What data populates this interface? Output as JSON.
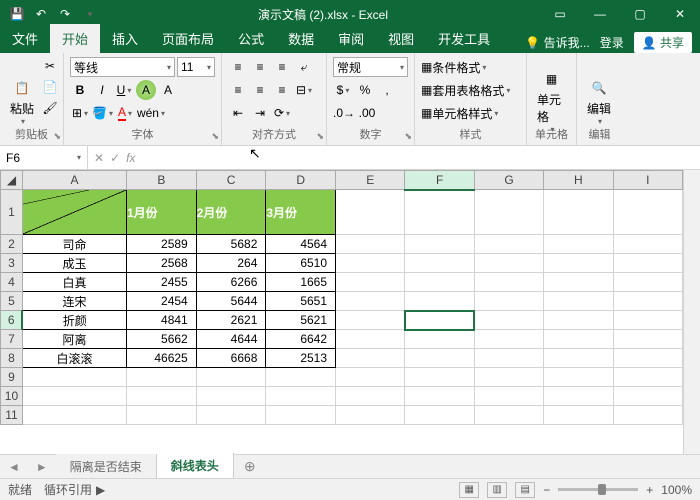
{
  "title": "演示文稿 (2).xlsx - Excel",
  "qat": {
    "save": "💾",
    "undo": "↶",
    "redo": "↷"
  },
  "tabs": {
    "file": "文件",
    "home": "开始",
    "insert": "插入",
    "layout": "页面布局",
    "formulas": "公式",
    "data": "数据",
    "review": "审阅",
    "view": "视图",
    "dev": "开发工具",
    "tell": "告诉我...",
    "login": "登录",
    "share": "共享"
  },
  "ribbon": {
    "clipboard": {
      "label": "剪贴板",
      "paste": "粘贴"
    },
    "font": {
      "label": "字体",
      "name": "等线",
      "size": "11",
      "bold": "B",
      "italic": "I",
      "underline": "U"
    },
    "align": {
      "label": "对齐方式"
    },
    "number": {
      "label": "数字",
      "format": "常规"
    },
    "styles": {
      "label": "样式",
      "cond": "条件格式",
      "table": "套用表格格式",
      "cell": "单元格样式"
    },
    "cells": {
      "label": "单元格"
    },
    "editing": {
      "label": "编辑"
    }
  },
  "namebox": "F6",
  "cols": [
    "A",
    "B",
    "C",
    "D",
    "E",
    "F",
    "G",
    "H",
    "I"
  ],
  "headers": [
    "",
    "1月份",
    "2月份",
    "3月份"
  ],
  "rows": [
    {
      "n": "司命",
      "v": [
        2589,
        5682,
        4564
      ]
    },
    {
      "n": "成玉",
      "v": [
        2568,
        264,
        6510
      ]
    },
    {
      "n": "白真",
      "v": [
        2455,
        6266,
        1665
      ]
    },
    {
      "n": "连宋",
      "v": [
        2454,
        5644,
        5651
      ]
    },
    {
      "n": "折颜",
      "v": [
        4841,
        2621,
        5621
      ]
    },
    {
      "n": "阿离",
      "v": [
        5662,
        4644,
        6642
      ]
    },
    {
      "n": "白滚滚",
      "v": [
        46625,
        6668,
        2513
      ]
    }
  ],
  "sheets": {
    "s1": "隔离是否结束",
    "s2": "斜线表头"
  },
  "status": {
    "ready": "就绪",
    "circ": "循环引用",
    "zoom": "100%"
  },
  "colwidths": {
    "rh": 22,
    "A": 105,
    "B": 70,
    "C": 70,
    "D": 70,
    "def": 70
  }
}
